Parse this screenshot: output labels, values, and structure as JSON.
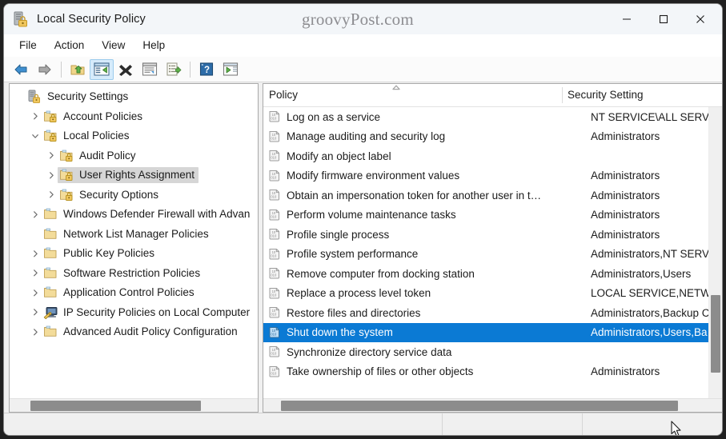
{
  "window": {
    "title": "Local Security Policy",
    "app_icon": "security-policy-icon",
    "watermark": "groovyPost.com",
    "controls": {
      "minimize": "minimize-button",
      "maximize": "maximize-button",
      "close": "close-button"
    }
  },
  "menubar": {
    "items": [
      {
        "label": "File"
      },
      {
        "label": "Action"
      },
      {
        "label": "View"
      },
      {
        "label": "Help"
      }
    ]
  },
  "toolbar": {
    "buttons": [
      {
        "name": "back-button",
        "icon": "arrow-left-icon",
        "active": false
      },
      {
        "name": "forward-button",
        "icon": "arrow-right-icon",
        "active": false
      },
      {
        "name": "separator-1",
        "icon": "separator",
        "active": false
      },
      {
        "name": "up-one-level-button",
        "icon": "folder-up-icon",
        "active": false
      },
      {
        "name": "show-hide-console-tree-button",
        "icon": "console-tree-icon",
        "active": true
      },
      {
        "name": "delete-button",
        "icon": "delete-x-icon",
        "active": false
      },
      {
        "name": "properties-button",
        "icon": "properties-icon",
        "active": false
      },
      {
        "name": "export-list-button",
        "icon": "export-list-icon",
        "active": false
      },
      {
        "name": "separator-2",
        "icon": "separator",
        "active": false
      },
      {
        "name": "help-button",
        "icon": "help-question-icon",
        "active": false
      },
      {
        "name": "show-action-pane-button",
        "icon": "action-pane-icon",
        "active": false
      }
    ]
  },
  "tree": {
    "nodes": [
      {
        "label": "Security Settings",
        "depth": 0,
        "twist": "none",
        "icon": "security-settings-icon",
        "selected": false
      },
      {
        "label": "Account Policies",
        "depth": 1,
        "twist": "collapsed",
        "icon": "policy-folder-icon",
        "selected": false
      },
      {
        "label": "Local Policies",
        "depth": 1,
        "twist": "expanded",
        "icon": "policy-folder-icon",
        "selected": false
      },
      {
        "label": "Audit Policy",
        "depth": 2,
        "twist": "collapsed",
        "icon": "policy-folder-icon",
        "selected": false
      },
      {
        "label": "User Rights Assignment",
        "depth": 2,
        "twist": "collapsed",
        "icon": "policy-folder-icon",
        "selected": true
      },
      {
        "label": "Security Options",
        "depth": 2,
        "twist": "collapsed",
        "icon": "policy-folder-icon",
        "selected": false
      },
      {
        "label": "Windows Defender Firewall with Advan",
        "depth": 1,
        "twist": "collapsed",
        "icon": "plain-folder-icon",
        "selected": false
      },
      {
        "label": "Network List Manager Policies",
        "depth": 1,
        "twist": "none",
        "icon": "plain-folder-icon",
        "selected": false
      },
      {
        "label": "Public Key Policies",
        "depth": 1,
        "twist": "collapsed",
        "icon": "plain-folder-icon",
        "selected": false
      },
      {
        "label": "Software Restriction Policies",
        "depth": 1,
        "twist": "collapsed",
        "icon": "plain-folder-icon",
        "selected": false
      },
      {
        "label": "Application Control Policies",
        "depth": 1,
        "twist": "collapsed",
        "icon": "plain-folder-icon",
        "selected": false
      },
      {
        "label": "IP Security Policies on Local Computer",
        "depth": 1,
        "twist": "collapsed",
        "icon": "ip-security-icon",
        "selected": false
      },
      {
        "label": "Advanced Audit Policy Configuration",
        "depth": 1,
        "twist": "collapsed",
        "icon": "plain-folder-icon",
        "selected": false
      }
    ]
  },
  "list": {
    "columns": [
      {
        "label": "Policy",
        "sorted": "ascending"
      },
      {
        "label": "Security Setting",
        "sorted": "none"
      }
    ],
    "rows": [
      {
        "policy": "Log on as a service",
        "setting": "NT SERVICE\\ALL SERVICE",
        "selected": false
      },
      {
        "policy": "Manage auditing and security log",
        "setting": "Administrators",
        "selected": false
      },
      {
        "policy": "Modify an object label",
        "setting": "",
        "selected": false
      },
      {
        "policy": "Modify firmware environment values",
        "setting": "Administrators",
        "selected": false
      },
      {
        "policy": "Obtain an impersonation token for another user in t…",
        "setting": "Administrators",
        "selected": false
      },
      {
        "policy": "Perform volume maintenance tasks",
        "setting": "Administrators",
        "selected": false
      },
      {
        "policy": "Profile single process",
        "setting": "Administrators",
        "selected": false
      },
      {
        "policy": "Profile system performance",
        "setting": "Administrators,NT SERV",
        "selected": false
      },
      {
        "policy": "Remove computer from docking station",
        "setting": "Administrators,Users",
        "selected": false
      },
      {
        "policy": "Replace a process level token",
        "setting": "LOCAL SERVICE,NETWOI",
        "selected": false
      },
      {
        "policy": "Restore files and directories",
        "setting": "Administrators,Backup C",
        "selected": false
      },
      {
        "policy": "Shut down the system",
        "setting": "Administrators,Users,Ba",
        "selected": true
      },
      {
        "policy": "Synchronize directory service data",
        "setting": "",
        "selected": false
      },
      {
        "policy": "Take ownership of files or other objects",
        "setting": "Administrators",
        "selected": false
      }
    ]
  },
  "colors": {
    "selection_blue": "#0b7ad4",
    "tree_selection_gray": "#d6d6d6",
    "titlebar": "#f3f6f9",
    "scrollbar_thumb": "#8c8c8c"
  },
  "statusbar": {
    "text": ""
  }
}
